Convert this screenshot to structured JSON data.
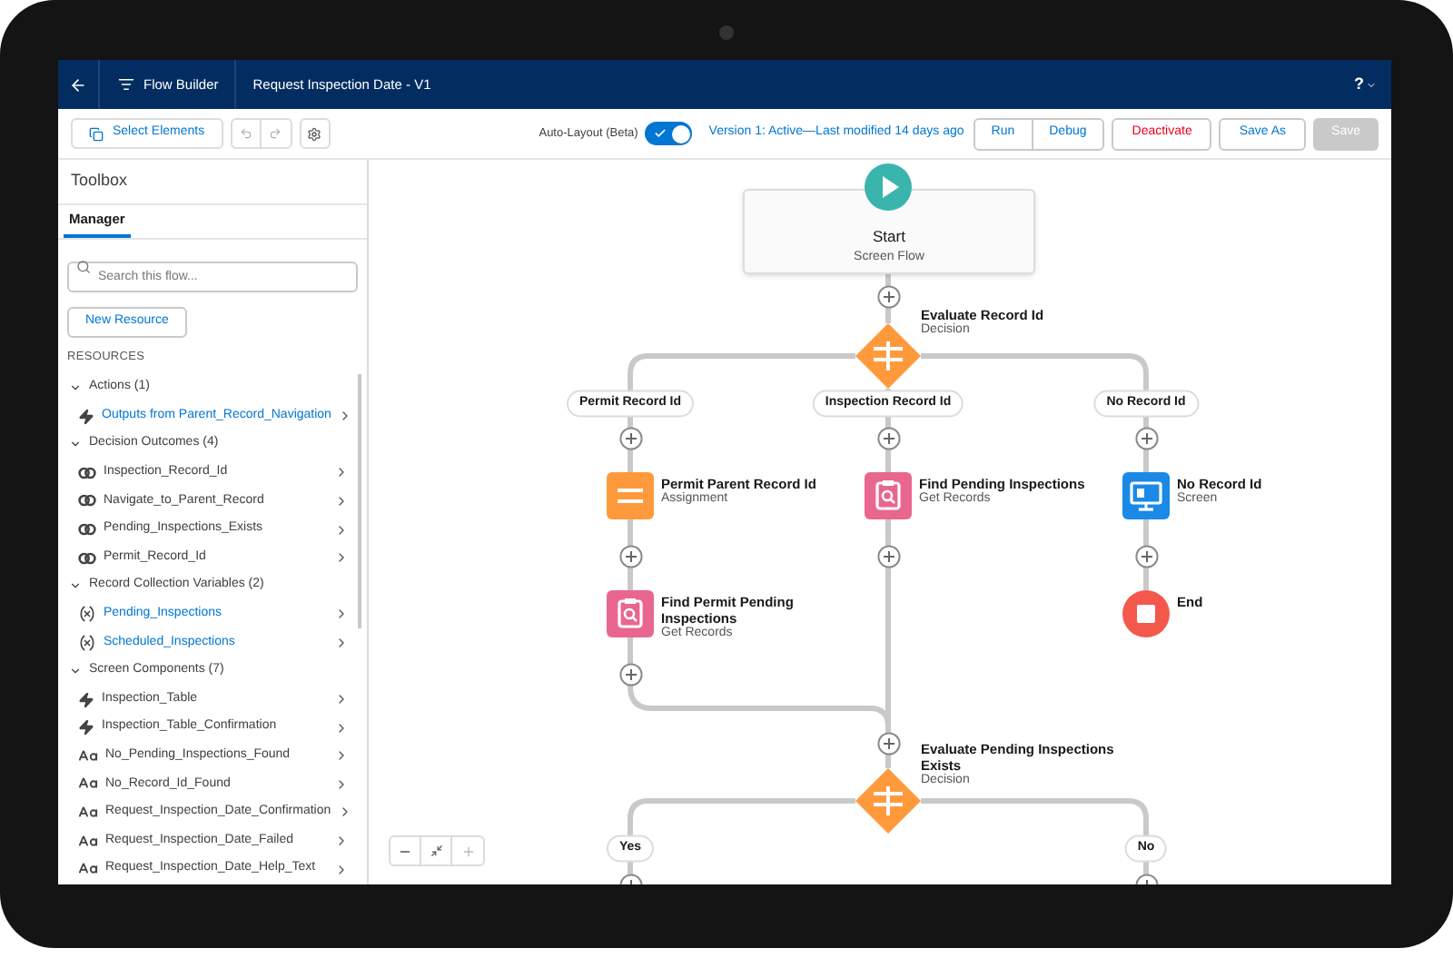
{
  "header": {
    "app_title": "Flow Builder",
    "flow_title": "Request Inspection Date - V1",
    "help_label": "?"
  },
  "toolbar": {
    "select_elements": "Select Elements",
    "auto_layout": {
      "label": "Auto-Layout (Beta)",
      "on": true
    },
    "version_text": "Version 1: Active—Last modified 14 days ago",
    "buttons": [
      {
        "label": "Run",
        "kind": "default"
      },
      {
        "label": "Debug",
        "kind": "default"
      },
      {
        "label": "Deactivate",
        "kind": "destructive"
      },
      {
        "label": "Save As",
        "kind": "default"
      },
      {
        "label": "Save",
        "kind": "disabled"
      }
    ]
  },
  "toolbox": {
    "title": "Toolbox",
    "tabs": [
      {
        "label": "Manager",
        "selected": true
      }
    ],
    "search": {
      "placeholder": "Search this flow..."
    },
    "new_resource": "New Resource",
    "section_label": "RESOURCES",
    "groups": [
      {
        "label": "Actions (1)",
        "expanded": true,
        "items": [
          {
            "label": "Outputs from Parent_Record_Navigation",
            "kind": "action",
            "link": true
          }
        ]
      },
      {
        "label": "Decision Outcomes (4)",
        "expanded": true,
        "items": [
          {
            "label": "Inspection_Record_Id",
            "kind": "outcome",
            "link": false
          },
          {
            "label": "Navigate_to_Parent_Record",
            "kind": "outcome",
            "link": false
          },
          {
            "label": "Pending_Inspections_Exists",
            "kind": "outcome",
            "link": false
          },
          {
            "label": "Permit_Record_Id",
            "kind": "outcome",
            "link": false
          }
        ]
      },
      {
        "label": "Record Collection Variables (2)",
        "expanded": true,
        "items": [
          {
            "label": "Pending_Inspections",
            "kind": "variable",
            "link": true
          },
          {
            "label": "Scheduled_Inspections",
            "kind": "variable",
            "link": true
          }
        ]
      },
      {
        "label": "Screen Components (7)",
        "expanded": true,
        "items": [
          {
            "label": "Inspection_Table",
            "kind": "action",
            "link": false
          },
          {
            "label": "Inspection_Table_Confirmation",
            "kind": "action",
            "link": false
          },
          {
            "label": "No_Pending_Inspections_Found",
            "kind": "text",
            "link": false
          },
          {
            "label": "No_Record_Id_Found",
            "kind": "text",
            "link": false
          },
          {
            "label": "Request_Inspection_Date_Confirmation",
            "kind": "text",
            "link": false
          },
          {
            "label": "Request_Inspection_Date_Failed",
            "kind": "text",
            "link": false
          },
          {
            "label": "Request_Inspection_Date_Help_Text",
            "kind": "text",
            "link": false
          }
        ]
      }
    ]
  },
  "canvas": {
    "nodes": [
      {
        "kind": "start",
        "label": "Start",
        "subtitle": "Screen Flow"
      },
      {
        "kind": "decision",
        "label": "Evaluate Record Id",
        "subtitle": "Decision"
      },
      {
        "kind": "assignment",
        "label": "Permit Parent Record Id",
        "subtitle": "Assignment"
      },
      {
        "kind": "get_records",
        "label": "Find Pending Inspections",
        "subtitle": "Get Records"
      },
      {
        "kind": "screen",
        "label": "No Record Id",
        "subtitle": "Screen"
      },
      {
        "kind": "get_records",
        "label": "Find Permit Pending Inspections",
        "subtitle": "Get Records"
      },
      {
        "kind": "end",
        "label": "End"
      },
      {
        "kind": "decision",
        "label": "Evaluate Pending Inspections Exists",
        "subtitle": "Decision"
      }
    ],
    "branch_labels": [
      "Permit Record Id",
      "Inspection Record Id",
      "No Record Id",
      "Yes",
      "No"
    ]
  }
}
